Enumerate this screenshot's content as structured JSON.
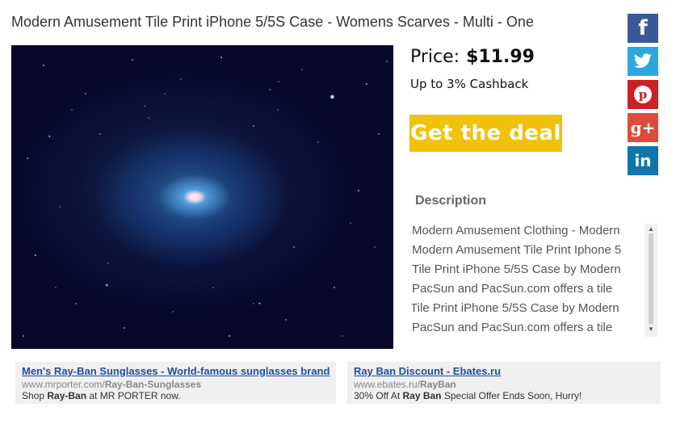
{
  "title": "Modern Amusement Tile Print iPhone 5/5S Case - Womens Scarves - Multi - One",
  "price": {
    "label": "Price:",
    "value": "$11.99"
  },
  "cashback": "Up to 3% Cashback",
  "deal_button": "Get the deal",
  "social": [
    {
      "name": "facebook",
      "glyph": "f",
      "color": "#3b5998"
    },
    {
      "name": "twitter",
      "glyph": "t",
      "color": "#2ca7e0"
    },
    {
      "name": "pinterest",
      "glyph": "P",
      "color": "#cb2027"
    },
    {
      "name": "google-plus",
      "glyph": "g+",
      "color": "#dd4b39"
    },
    {
      "name": "linkedin",
      "glyph": "in",
      "color": "#0e76a8"
    }
  ],
  "description": {
    "heading": "Description",
    "lines": [
      "Modern Amusement Clothing - Modern",
      "Modern Amusement Tile Print Iphone 5",
      "Tile Print iPhone 5/5S Case by Modern",
      "PacSun and PacSun.com offers a tile",
      "Tile Print iPhone 5/5S Case by Modern",
      "PacSun and PacSun.com offers a tile"
    ]
  },
  "ads": [
    {
      "title": "Men's Ray-Ban Sunglasses - World-famous sunglasses brand",
      "url_prefix": "www.mrporter.com/",
      "url_bold": "Ray-Ban-Sunglasses",
      "text_prefix": "Shop ",
      "text_bold": "Ray-Ban",
      "text_suffix": " at MR PORTER now."
    },
    {
      "title": "Ray Ban Discount - Ebates.ru",
      "url_prefix": "www.ebates.ru/",
      "url_bold": "RayBan",
      "text_prefix": "30% Off At ",
      "text_bold": "Ray Ban",
      "text_suffix": " Special Offer Ends Soon, Hurry!"
    }
  ]
}
